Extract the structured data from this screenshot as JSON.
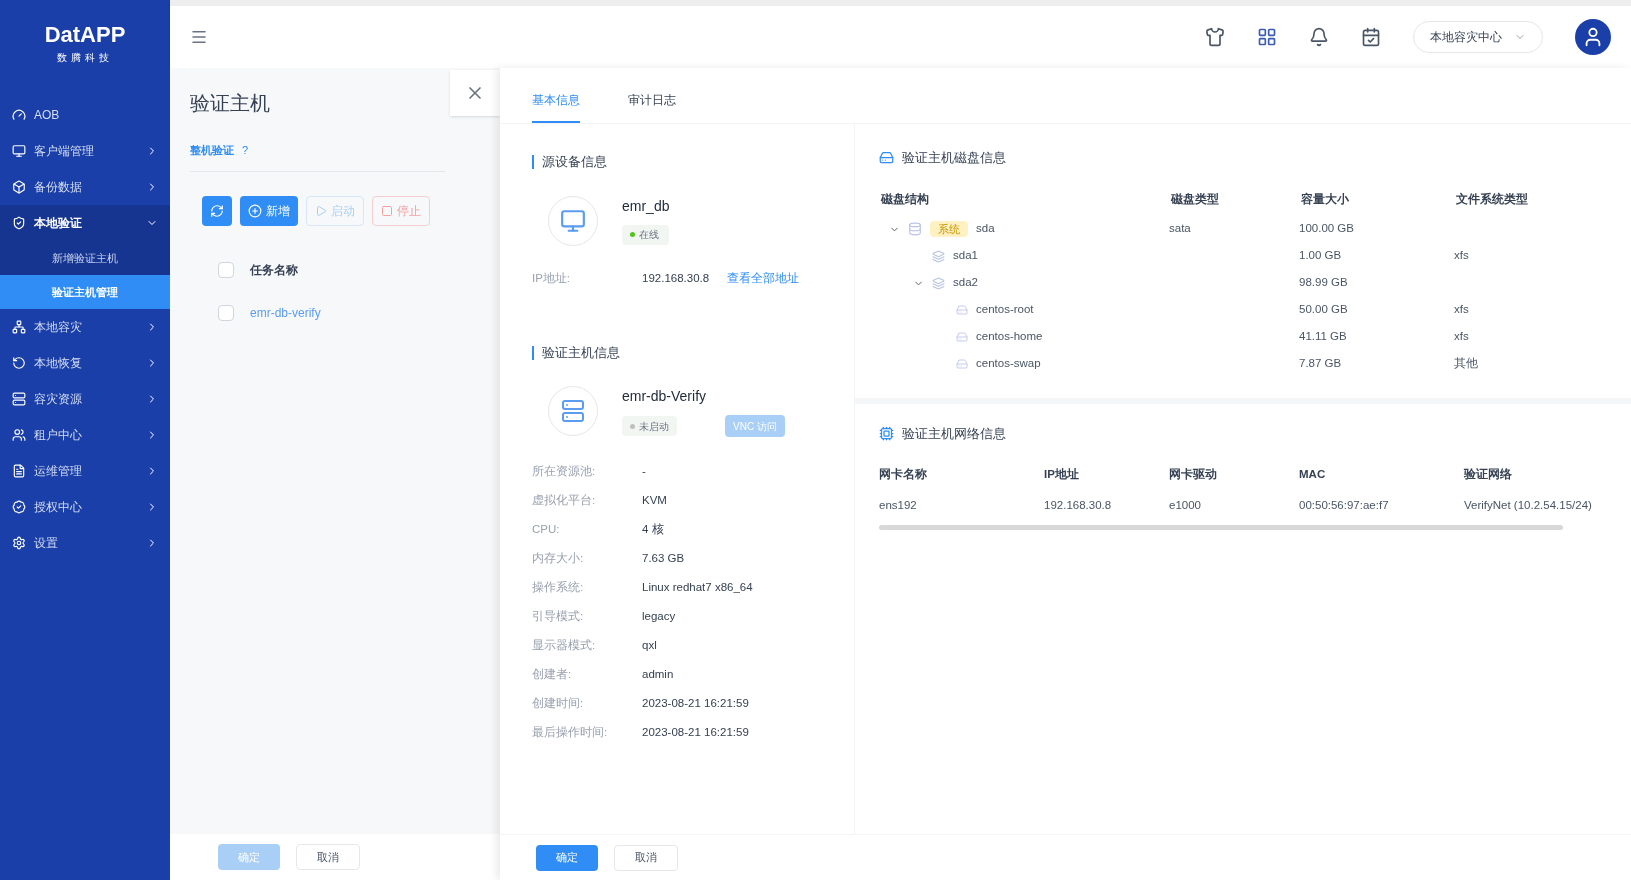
{
  "sidebar": {
    "logo": "DatAPP",
    "logo_sub": "数腾科技",
    "items": [
      {
        "kind": "link",
        "label": "AOB",
        "selected": false
      },
      {
        "kind": "menu",
        "label": "客户端管理",
        "expanded": false,
        "selected": false
      },
      {
        "kind": "menu",
        "label": "备份数据",
        "expanded": false,
        "selected": false
      },
      {
        "kind": "menu",
        "label": "本地验证",
        "expanded": true,
        "selected": false,
        "children": [
          {
            "label": "新增验证主机",
            "selected": false
          },
          {
            "label": "验证主机管理",
            "selected": true
          }
        ]
      },
      {
        "kind": "menu",
        "label": "本地容灾",
        "expanded": false,
        "selected": false
      },
      {
        "kind": "menu",
        "label": "本地恢复",
        "expanded": false,
        "selected": false
      },
      {
        "kind": "menu",
        "label": "容灾资源",
        "expanded": false,
        "selected": false
      },
      {
        "kind": "menu",
        "label": "租户中心",
        "expanded": false,
        "selected": false
      },
      {
        "kind": "menu",
        "label": "运维管理",
        "expanded": false,
        "selected": false
      },
      {
        "kind": "menu",
        "label": "授权中心",
        "expanded": false,
        "selected": false
      },
      {
        "kind": "menu",
        "label": "设置",
        "expanded": false,
        "selected": false
      }
    ]
  },
  "header": {
    "center": "本地容灾中心"
  },
  "page": {
    "title": "验证主机",
    "tab": "整机验证",
    "help": "?",
    "toolbar": [
      {
        "kind": "refresh",
        "disabled": false
      },
      {
        "kind": "add",
        "label": "新增",
        "disabled": false
      },
      {
        "kind": "start",
        "label": "启动",
        "disabled": true
      },
      {
        "kind": "stop",
        "label": "停止",
        "disabled": true
      }
    ],
    "table": {
      "column": "任务名称",
      "all_checked": false,
      "rows": [
        {
          "name": "emr-db-verify",
          "checked": false
        }
      ]
    },
    "footer": [
      {
        "label": "确定",
        "primary": true,
        "disabled": true
      },
      {
        "label": "取消",
        "primary": false
      }
    ]
  },
  "drawer": {
    "tabs": [
      {
        "label": "基本信息",
        "selected": true
      },
      {
        "label": "审计日志",
        "selected": false
      }
    ],
    "source": {
      "title": "源设备信息",
      "name": "emr_db",
      "status": {
        "label": "在线",
        "color": "#52c41a"
      },
      "ip_label": "IP地址:",
      "ip": "192.168.30.8",
      "ip_link": "查看全部地址"
    },
    "host": {
      "title": "验证主机信息",
      "name": "emr-db-Verify",
      "status": {
        "label": "未启动",
        "color": "#bfbfbf"
      },
      "vnc": {
        "label": "VNC 访问",
        "disabled": true
      },
      "fields": [
        {
          "label": "所在资源池:",
          "value": "-"
        },
        {
          "label": "虚拟化平台:",
          "value": "KVM"
        },
        {
          "label": "CPU:",
          "value": "4 核"
        },
        {
          "label": "内存大小:",
          "value": "7.63 GB"
        },
        {
          "label": "操作系统:",
          "value": "Linux redhat7 x86_64"
        },
        {
          "label": "引导模式:",
          "value": "legacy"
        },
        {
          "label": "显示器模式:",
          "value": "qxl"
        },
        {
          "label": "创建者:",
          "value": "admin"
        },
        {
          "label": "创建时间:",
          "value": "2023-08-21 16:21:59"
        },
        {
          "label": "最后操作时间:",
          "value": "2023-08-21 16:21:59"
        }
      ]
    },
    "disk": {
      "title": "验证主机磁盘信息",
      "columns": [
        "磁盘结构",
        "磁盘类型",
        "容量大小",
        "文件系统类型"
      ],
      "rows": [
        {
          "kind": "disk",
          "name": "sda",
          "tag": "系统",
          "type": "sata",
          "size": "100.00 GB",
          "expanded": true,
          "children": [
            {
              "kind": "part",
              "name": "sda1",
              "size": "1.00 GB",
              "fs": "xfs"
            },
            {
              "kind": "part",
              "name": "sda2",
              "size": "98.99 GB",
              "expanded": true,
              "children": [
                {
                  "kind": "lv",
                  "name": "centos-root",
                  "size": "50.00 GB",
                  "fs": "xfs"
                },
                {
                  "kind": "lv",
                  "name": "centos-home",
                  "size": "41.11 GB",
                  "fs": "xfs"
                },
                {
                  "kind": "lv",
                  "name": "centos-swap",
                  "size": "7.87 GB",
                  "fs": "其他"
                }
              ]
            }
          ]
        }
      ]
    },
    "network": {
      "title": "验证主机网络信息",
      "columns": [
        "网卡名称",
        "IP地址",
        "网卡驱动",
        "MAC",
        "验证网络"
      ],
      "rows": [
        [
          "ens192",
          "192.168.30.8",
          "e1000",
          "00:50:56:97:ae:f7",
          "VerifyNet (10.2.54.15/24)"
        ]
      ]
    },
    "footer": [
      {
        "label": "确定",
        "primary": true
      },
      {
        "label": "取消",
        "primary": false
      }
    ]
  }
}
